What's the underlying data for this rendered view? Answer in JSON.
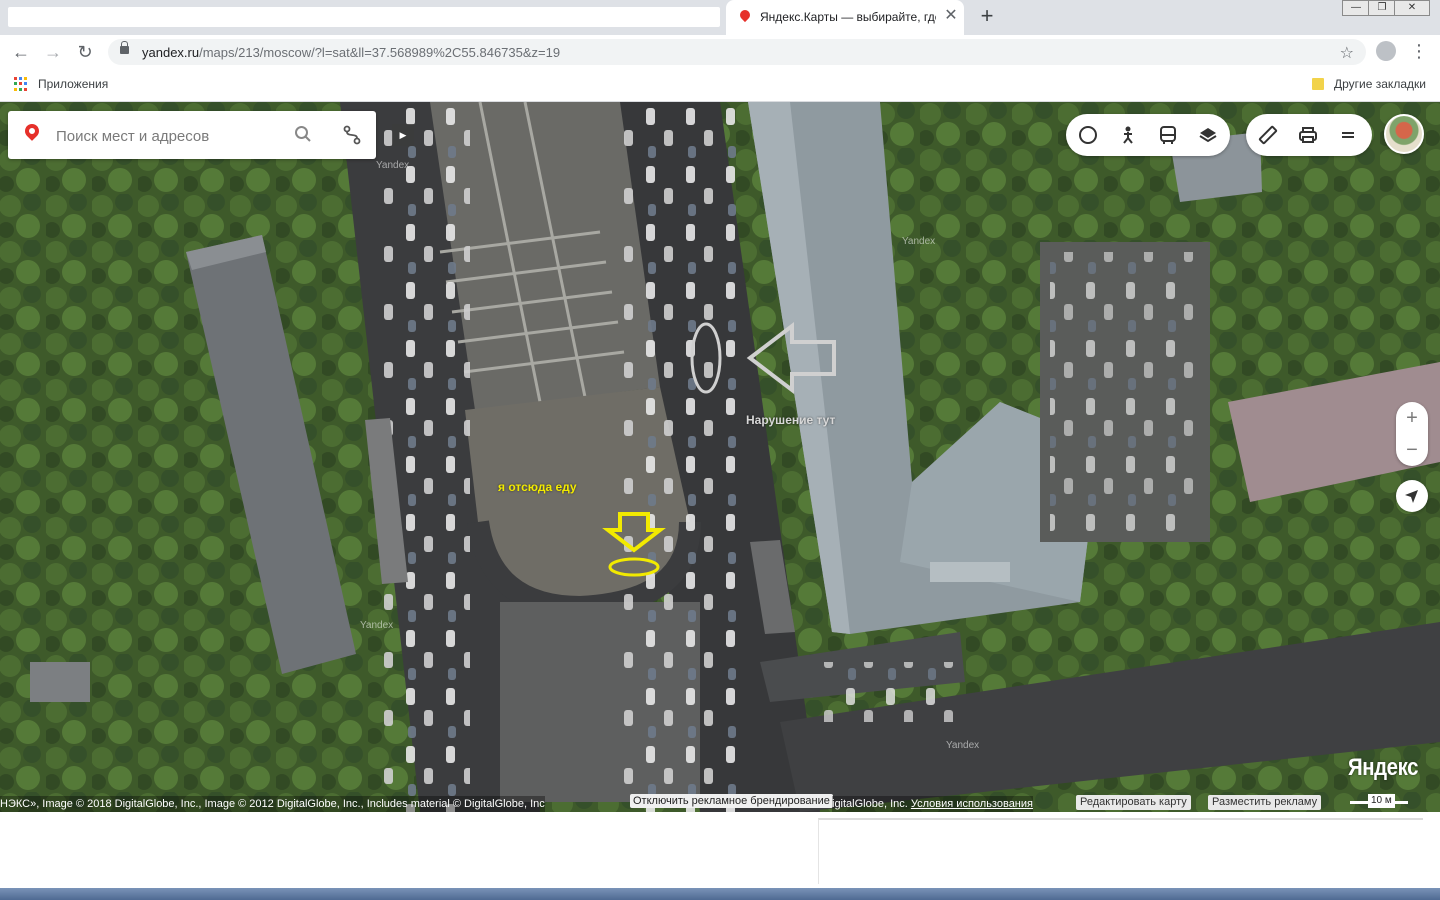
{
  "browser": {
    "active_tab_title": "Яндекс.Карты — выбирайте, где",
    "new_tab_symbol": "+",
    "close_symbol": "✕",
    "window_controls": {
      "minimize": "—",
      "maximize": "❐",
      "close": "✕"
    },
    "url_host": "yandex.ru",
    "url_rest": "/maps/213/moscow/?l=sat&ll=37.568989%2C55.846735&z=19",
    "nav": {
      "back": "←",
      "forward": "→",
      "reload": "↻"
    },
    "bookmark_star": "☆",
    "menu_symbol": "⋮",
    "bookmarks": {
      "apps_label": "Приложения",
      "other_label": "Другие закладки"
    }
  },
  "map": {
    "search": {
      "placeholder": "Поиск мест и адресов"
    },
    "collapse_symbol": "▶",
    "controls": {
      "left_group": [
        "panorama-icon",
        "pedestrian-icon",
        "transit-icon",
        "layers-icon"
      ],
      "right_group": [
        "ruler-icon",
        "print-icon",
        "menu-icon"
      ]
    },
    "zoom_in": "+",
    "zoom_out": "−",
    "annotations": {
      "violation": "Нарушение тут",
      "origin": "я отсюда еду",
      "violation_marker_color": "#d0d0d0",
      "origin_marker_color": "#f2ea00"
    },
    "watermark": "Yandex",
    "brand": "Яндекс",
    "copyright": "НЭКС», Image © 2018 DigitalGlobe, Inc., Image © 2012 DigitalGlobe, Inc., Includes material © DigitalGlobe, Inc",
    "copyright_tail": "igitalGlobe, Inc.",
    "terms_link": "Условия использования",
    "branding_off": "Отключить рекламное брендирование",
    "edit_map": "Редактировать карту",
    "advertise": "Разместить рекламу",
    "scale_label": "10 м"
  }
}
